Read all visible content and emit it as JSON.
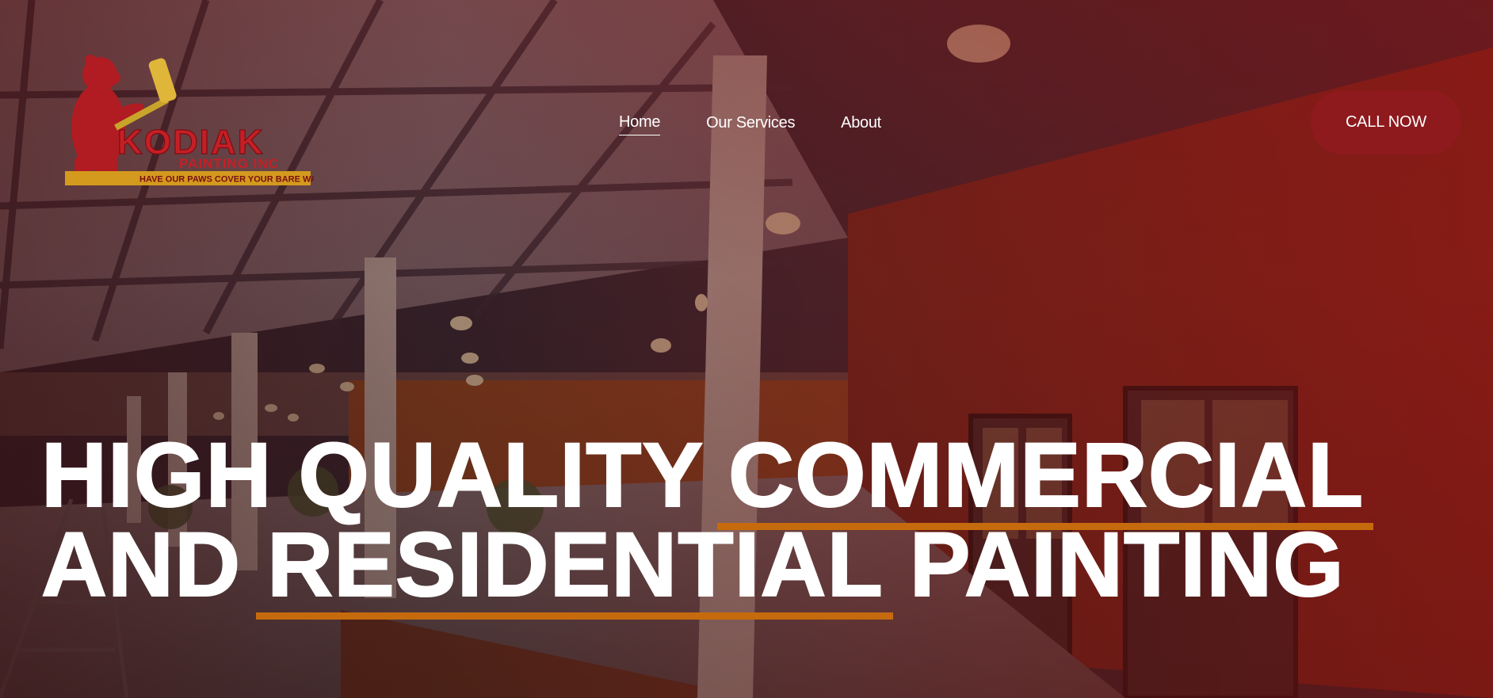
{
  "brand": {
    "name": "KODIAK",
    "subname": "PAINTING INC",
    "tagline": "HAVE OUR PAWS COVER YOUR BARE WALLS",
    "primary_color": "#8e1a1e",
    "accent_color": "#c66a0e"
  },
  "nav": {
    "items": [
      {
        "label": "Home",
        "active": true
      },
      {
        "label": "Our Services",
        "active": false
      },
      {
        "label": "About",
        "active": false
      }
    ]
  },
  "cta": {
    "label": "CALL NOW"
  },
  "hero": {
    "line1_plain": "HIGH QUALITY ",
    "line1_highlight": "COMMERCIAL",
    "line2_plain_before": "AND ",
    "line2_highlight": "RESIDENTIAL",
    "line2_plain_after": " PAINTING"
  }
}
